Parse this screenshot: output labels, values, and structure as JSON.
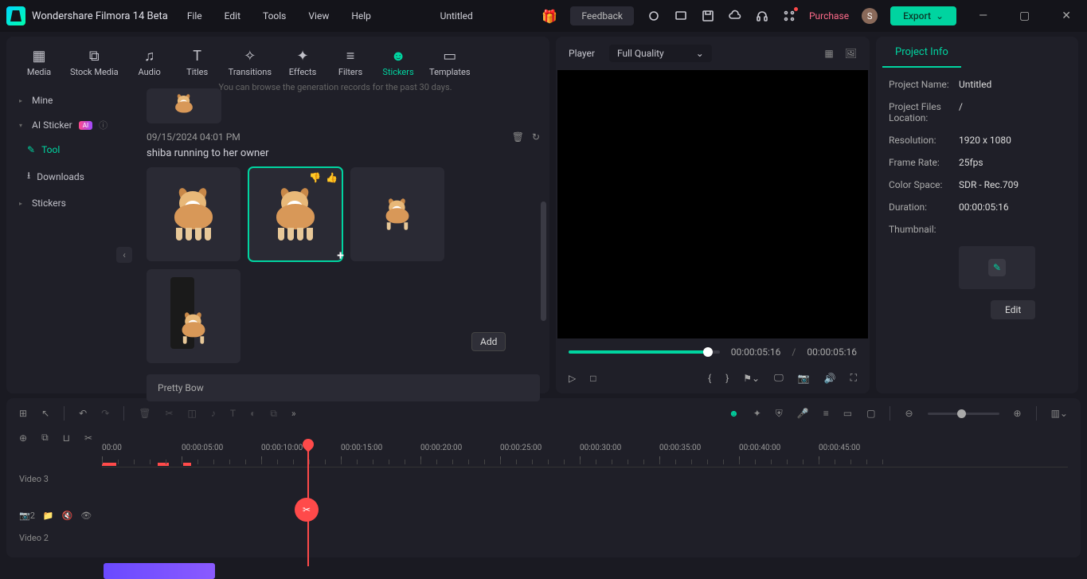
{
  "app": {
    "title": "Wondershare Filmora 14 Beta",
    "doc": "Untitled"
  },
  "menu": [
    "File",
    "Edit",
    "Tools",
    "View",
    "Help"
  ],
  "titlebar": {
    "feedback": "Feedback",
    "purchase": "Purchase",
    "export": "Export",
    "avatar": "S"
  },
  "tabs": [
    {
      "icon": "⬚",
      "label": "Media"
    },
    {
      "icon": "⧉",
      "label": "Stock Media"
    },
    {
      "icon": "♫",
      "label": "Audio"
    },
    {
      "icon": "T",
      "label": "Titles"
    },
    {
      "icon": "⇄",
      "label": "Transitions"
    },
    {
      "icon": "✦",
      "label": "Effects"
    },
    {
      "icon": "≋",
      "label": "Filters"
    },
    {
      "icon": "☺",
      "label": "Stickers"
    },
    {
      "icon": "▭",
      "label": "Templates"
    }
  ],
  "sidebar": {
    "mine": "Mine",
    "ai": "AI Sticker",
    "ai_badge": "AI",
    "tool": "Tool",
    "downloads": "Downloads",
    "stickers": "Stickers"
  },
  "content": {
    "hint": "You can browse the generation records for the past 30 days.",
    "timestamp": "09/15/2024 04:01 PM",
    "prompt": "shiba running to her owner",
    "add_tooltip": "Add",
    "search": "Pretty Bow"
  },
  "preview": {
    "player": "Player",
    "quality": "Full Quality",
    "current": "00:00:05:16",
    "total": "00:00:05:16"
  },
  "info": {
    "tab": "Project Info",
    "rows": {
      "name_l": "Project Name:",
      "name_v": "Untitled",
      "loc_l": "Project Files Location:",
      "loc_v": "/",
      "res_l": "Resolution:",
      "res_v": "1920 x 1080",
      "fr_l": "Frame Rate:",
      "fr_v": "25fps",
      "cs_l": "Color Space:",
      "cs_v": "SDR - Rec.709",
      "dur_l": "Duration:",
      "dur_v": "00:00:05:16",
      "th_l": "Thumbnail:"
    },
    "edit": "Edit"
  },
  "timeline": {
    "ticks": [
      "00:00",
      "00:00:05:00",
      "00:00:10:00",
      "00:00:15:00",
      "00:00:20:00",
      "00:00:25:00",
      "00:00:30:00",
      "00:00:35:00",
      "00:00:40:00",
      "00:00:45:00"
    ],
    "track3": "Video 3",
    "track2": "Video 2"
  }
}
